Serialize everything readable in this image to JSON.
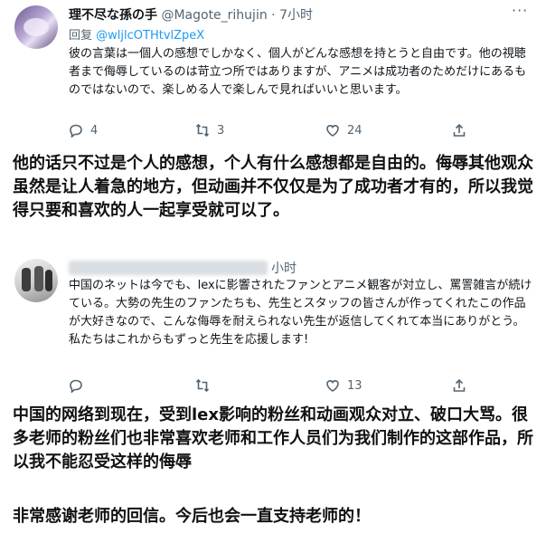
{
  "tweet1": {
    "display_name": "理不尽な孫の手",
    "handle": "@Magote_rihujin",
    "time": "7小时",
    "reply_prefix": "回复",
    "reply_to": "@wljlcOTHtvlZpeX",
    "body": "彼の言葉は一個人の感想でしかなく、個人がどんな感想を持とうと自由です。他の視聴者まで侮辱しているのは苛立つ所ではありますが、アニメは成功者のためだけにあるものではないので、楽しめる人で楽しんで見ればいいと思います。",
    "reply_count": "4",
    "retweet_count": "3",
    "like_count": "24"
  },
  "translation1": "他的话只不过是个人的感想，个人有什么感想都是自由的。侮辱其他观众虽然是让人着急的地方，但动画并不仅仅是为了成功者才有的，所以我觉得只要和喜欢的人一起享受就可以了。",
  "tweet2": {
    "time": "小时",
    "body": "中国のネットは今でも、lexに影響されたファンとアニメ観客が対立し、罵詈雑言が続けている。大勢の先生のファンたちも、先生とスタッフの皆さんが作ってくれたこの作品が大好きなので、こんな侮辱を耐えられない先生が返信してくれて本当にありがとう。私たちはこれからもずっと先生を応援します!",
    "reply_count": "",
    "retweet_count": "",
    "like_count": "13"
  },
  "translation2": "中国的网络到现在，受到lex影响的粉丝和动画观众对立、破口大骂。很多老师的粉丝们也非常喜欢老师和工作人员们为我们制作的这部作品，所以我不能忍受这样的侮辱",
  "translation3": "非常感谢老师的回信。今后也会一直支持老师的！",
  "icons": {
    "reply": "reply-icon",
    "retweet": "retweet-icon",
    "like": "heart-icon",
    "share": "share-icon",
    "more": "more-icon"
  },
  "colors": {
    "accent": "#1d9bf0",
    "secondary_text": "#536471"
  }
}
